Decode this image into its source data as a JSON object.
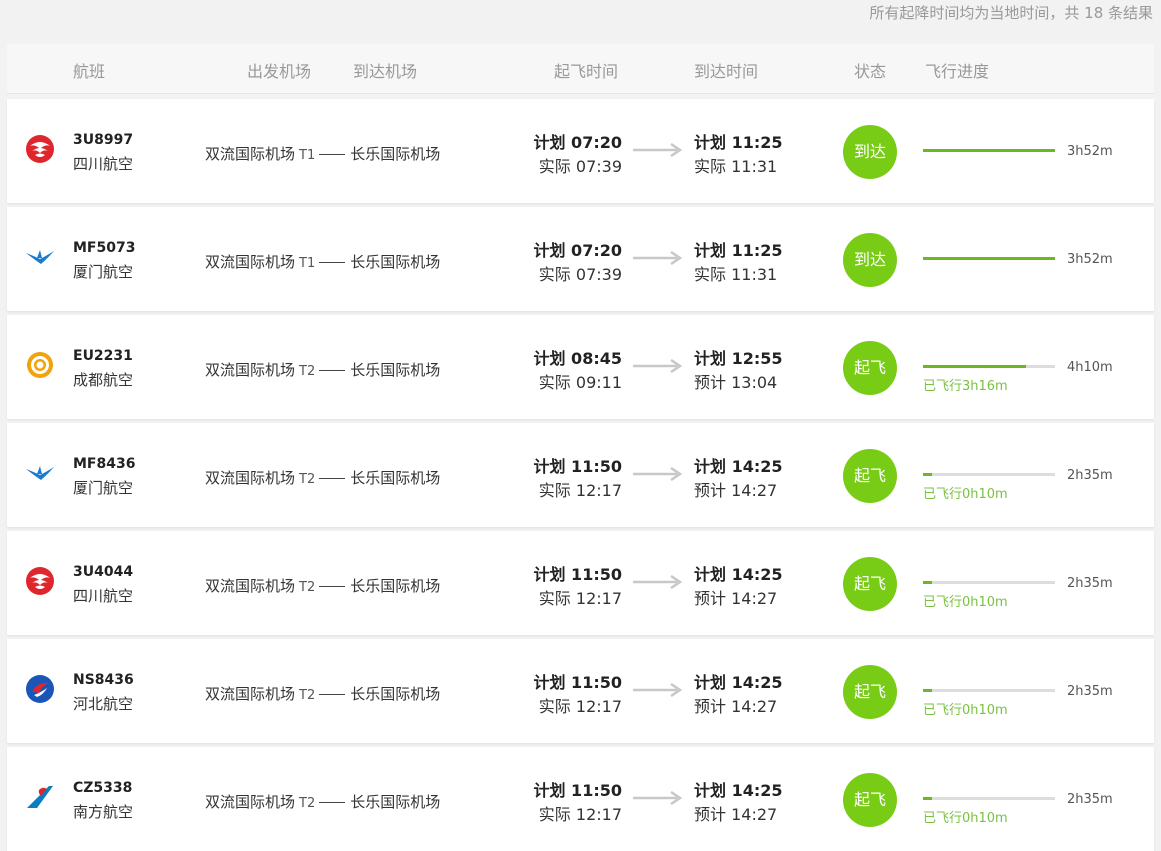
{
  "summary": "所有起降时间均为当地时间，共 18 条结果",
  "header": {
    "flight": "航班",
    "dep_airport": "出发机场",
    "arr_airport": "到达机场",
    "dep_time": "起飞时间",
    "arr_time": "到达时间",
    "status": "状态",
    "progress": "飞行进度"
  },
  "colors": {
    "accent": "#79cc16",
    "progress": "#6db81a",
    "flown_text": "#7ac142"
  },
  "flights": [
    {
      "logo": "sichuan-airlines-logo-icon",
      "flight_no": "3U8997",
      "airline": "四川航空",
      "dep_airport": "双流国际机场",
      "terminal": "T1",
      "arr_airport": "长乐国际机场",
      "dep_plan": "计划 07:20",
      "dep_actual": "实际 07:39",
      "arr_plan": "计划 11:25",
      "arr_actual": "实际 11:31",
      "status": "到达",
      "progress": 1.0,
      "duration": "3h52m",
      "flown": ""
    },
    {
      "logo": "xiamen-airlines-logo-icon",
      "flight_no": "MF5073",
      "airline": "厦门航空",
      "dep_airport": "双流国际机场",
      "terminal": "T1",
      "arr_airport": "长乐国际机场",
      "dep_plan": "计划 07:20",
      "dep_actual": "实际 07:39",
      "arr_plan": "计划 11:25",
      "arr_actual": "实际 11:31",
      "status": "到达",
      "progress": 1.0,
      "duration": "3h52m",
      "flown": ""
    },
    {
      "logo": "chengdu-airlines-logo-icon",
      "flight_no": "EU2231",
      "airline": "成都航空",
      "dep_airport": "双流国际机场",
      "terminal": "T2",
      "arr_airport": "长乐国际机场",
      "dep_plan": "计划 08:45",
      "dep_actual": "实际 09:11",
      "arr_plan": "计划 12:55",
      "arr_actual": "预计 13:04",
      "status": "起飞",
      "progress": 0.78,
      "duration": "4h10m",
      "flown": "已飞行3h16m"
    },
    {
      "logo": "xiamen-airlines-logo-icon",
      "flight_no": "MF8436",
      "airline": "厦门航空",
      "dep_airport": "双流国际机场",
      "terminal": "T2",
      "arr_airport": "长乐国际机场",
      "dep_plan": "计划 11:50",
      "dep_actual": "实际 12:17",
      "arr_plan": "计划 14:25",
      "arr_actual": "预计 14:27",
      "status": "起飞",
      "progress": 0.07,
      "duration": "2h35m",
      "flown": "已飞行0h10m"
    },
    {
      "logo": "sichuan-airlines-logo-icon",
      "flight_no": "3U4044",
      "airline": "四川航空",
      "dep_airport": "双流国际机场",
      "terminal": "T2",
      "arr_airport": "长乐国际机场",
      "dep_plan": "计划 11:50",
      "dep_actual": "实际 12:17",
      "arr_plan": "计划 14:25",
      "arr_actual": "预计 14:27",
      "status": "起飞",
      "progress": 0.07,
      "duration": "2h35m",
      "flown": "已飞行0h10m"
    },
    {
      "logo": "hebei-airlines-logo-icon",
      "flight_no": "NS8436",
      "airline": "河北航空",
      "dep_airport": "双流国际机场",
      "terminal": "T2",
      "arr_airport": "长乐国际机场",
      "dep_plan": "计划 11:50",
      "dep_actual": "实际 12:17",
      "arr_plan": "计划 14:25",
      "arr_actual": "预计 14:27",
      "status": "起飞",
      "progress": 0.07,
      "duration": "2h35m",
      "flown": "已飞行0h10m"
    },
    {
      "logo": "china-southern-logo-icon",
      "flight_no": "CZ5338",
      "airline": "南方航空",
      "dep_airport": "双流国际机场",
      "terminal": "T2",
      "arr_airport": "长乐国际机场",
      "dep_plan": "计划 11:50",
      "dep_actual": "实际 12:17",
      "arr_plan": "计划 14:25",
      "arr_actual": "预计 14:27",
      "status": "起飞",
      "progress": 0.07,
      "duration": "2h35m",
      "flown": "已飞行0h10m"
    }
  ]
}
